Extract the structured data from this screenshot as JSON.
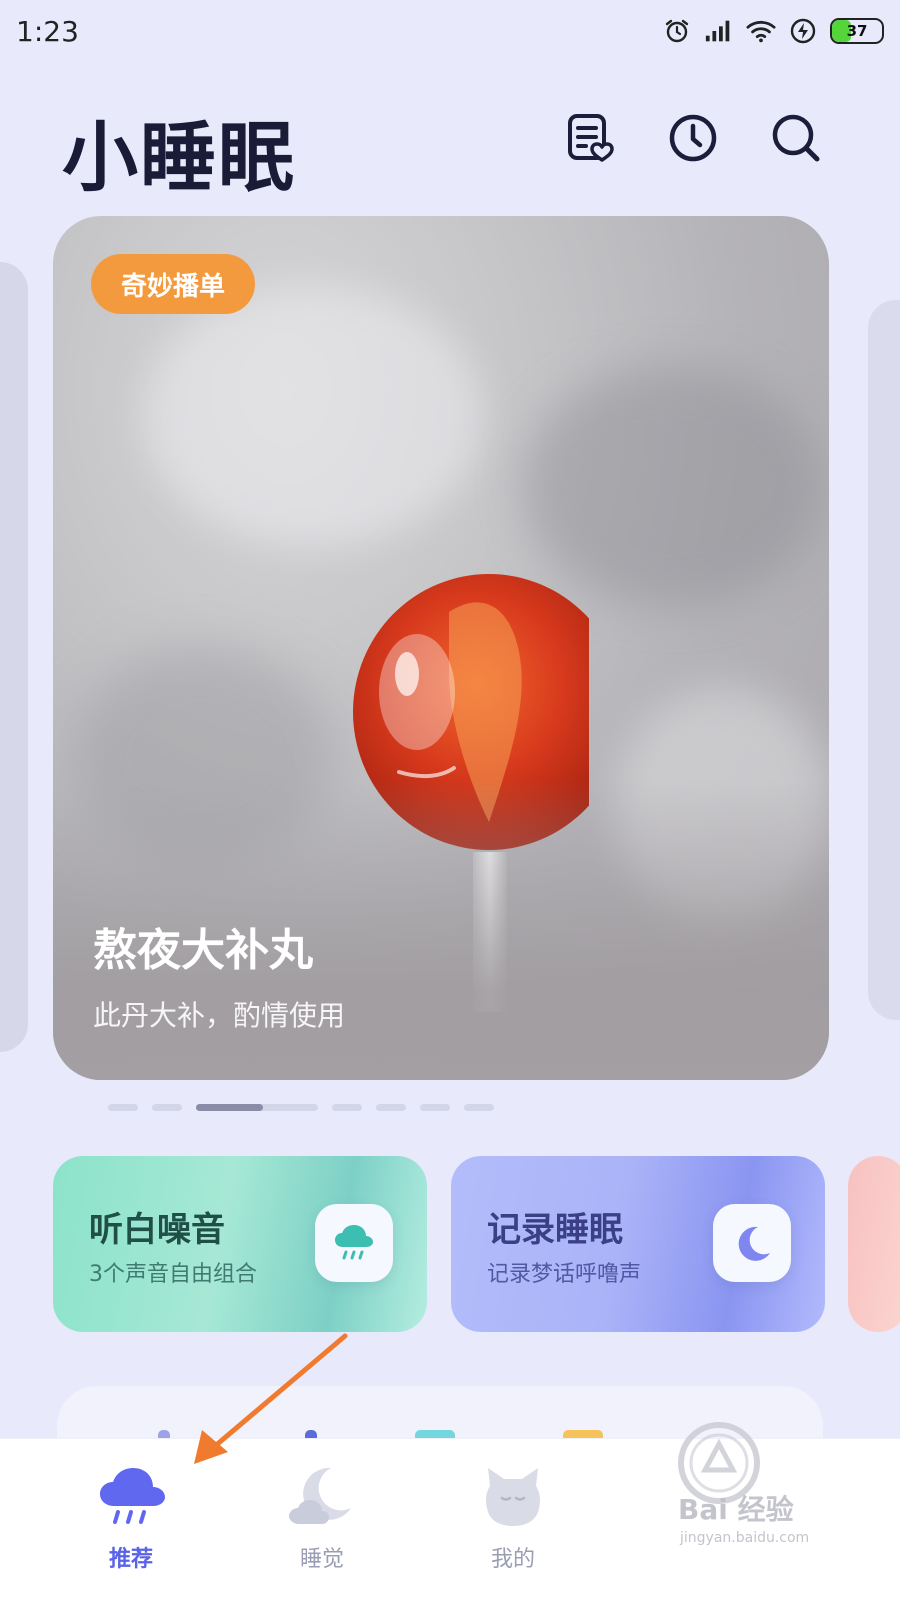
{
  "status_bar": {
    "time": "1:23",
    "battery": "37",
    "battery_level": 0.37
  },
  "header": {
    "title": "小睡眠"
  },
  "banner": {
    "tag": "奇妙播单",
    "title": "熬夜大补丸",
    "subtitle": "此丹大补，酌情使用"
  },
  "pager": {
    "count": 7,
    "active_index": 2,
    "active_progress": 0.55
  },
  "quick_cards": [
    {
      "title": "听白噪音",
      "subtitle": "3个声音自由组合",
      "icon": "rain-cloud-icon"
    },
    {
      "title": "记录睡眠",
      "subtitle": "记录梦话呼噜声",
      "icon": "moon-icon"
    }
  ],
  "tabs": [
    {
      "label": "推荐",
      "icon": "rain-cloud-icon",
      "active": true
    },
    {
      "label": "睡觉",
      "icon": "moon-cloud-icon",
      "active": false
    },
    {
      "label": "我的",
      "icon": "cat-icon",
      "active": false
    }
  ],
  "watermark": {
    "text": "Bai 经验",
    "sub": "jingyan.baidu.com"
  },
  "colors": {
    "accent": "#5a62e8",
    "tag": "#f49a3e",
    "background": "#e8eafc",
    "annotation_arrow": "#f07a2e"
  }
}
